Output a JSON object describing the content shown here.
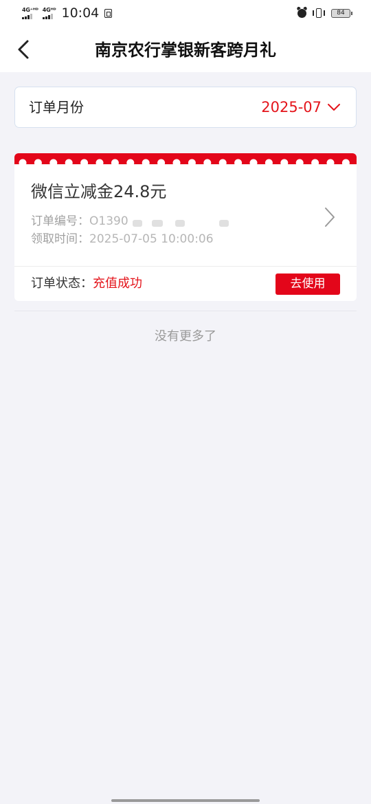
{
  "status_bar": {
    "network_1": "4G⁺ᴴᴰ",
    "network_2": "4Gᴴᴰ",
    "time": "10:04",
    "battery": "84"
  },
  "nav": {
    "title": "南京农行掌银新客跨月礼"
  },
  "filter": {
    "label": "订单月份",
    "value": "2025-07"
  },
  "order": {
    "title": "微信立减金24.8元",
    "number_label": "订单编号：",
    "number_value": "O1390",
    "time_label": "领取时间：",
    "time_value": "2025-07-05 10:00:06",
    "status_label": "订单状态：",
    "status_value": "充值成功",
    "action_label": "去使用"
  },
  "footer": {
    "no_more": "没有更多了"
  },
  "colors": {
    "accent": "#e4141b",
    "button": "#e3061a",
    "background": "#f3f3f8"
  }
}
